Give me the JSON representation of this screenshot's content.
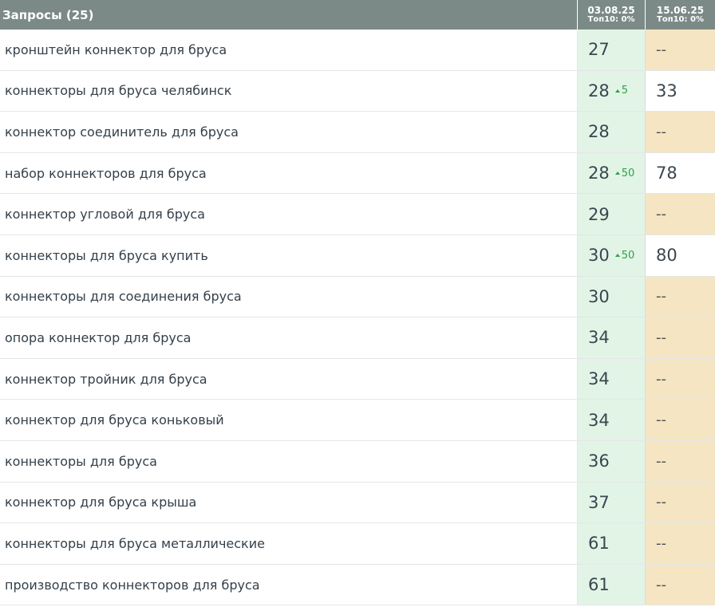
{
  "header": {
    "title": "Запросы (25)",
    "columns": [
      {
        "date": "03.08.25",
        "sub": "Топ10: 0%"
      },
      {
        "date": "15.06.25",
        "sub": "Топ10: 0%"
      }
    ]
  },
  "rows": [
    {
      "query": "кронштейн коннектор для бруса",
      "pos": "27",
      "delta": "",
      "prev": "--"
    },
    {
      "query": "коннекторы для бруса челябинск",
      "pos": "28",
      "delta": "5",
      "prev": "33"
    },
    {
      "query": "коннектор соединитель для бруса",
      "pos": "28",
      "delta": "",
      "prev": "--"
    },
    {
      "query": "набор коннекторов для бруса",
      "pos": "28",
      "delta": "50",
      "prev": "78"
    },
    {
      "query": "коннектор угловой для бруса",
      "pos": "29",
      "delta": "",
      "prev": "--"
    },
    {
      "query": "коннекторы для бруса купить",
      "pos": "30",
      "delta": "50",
      "prev": "80"
    },
    {
      "query": "коннекторы для соединения бруса",
      "pos": "30",
      "delta": "",
      "prev": "--"
    },
    {
      "query": "опора коннектор для бруса",
      "pos": "34",
      "delta": "",
      "prev": "--"
    },
    {
      "query": "коннектор тройник для бруса",
      "pos": "34",
      "delta": "",
      "prev": "--"
    },
    {
      "query": "коннектор для бруса коньковый",
      "pos": "34",
      "delta": "",
      "prev": "--"
    },
    {
      "query": "коннекторы для бруса",
      "pos": "36",
      "delta": "",
      "prev": "--"
    },
    {
      "query": "коннектор для бруса крыша",
      "pos": "37",
      "delta": "",
      "prev": "--"
    },
    {
      "query": "коннекторы для бруса металлические",
      "pos": "61",
      "delta": "",
      "prev": "--"
    },
    {
      "query": "производство коннекторов для бруса",
      "pos": "61",
      "delta": "",
      "prev": "--"
    }
  ],
  "colors": {
    "header_bg": "#7b8a86",
    "current_col_bg": "#e2f4e6",
    "empty_prev_bg": "#f5e5c2",
    "delta_up": "#2aa34a"
  },
  "icons": {
    "delta_up": "triangle-up-icon"
  }
}
